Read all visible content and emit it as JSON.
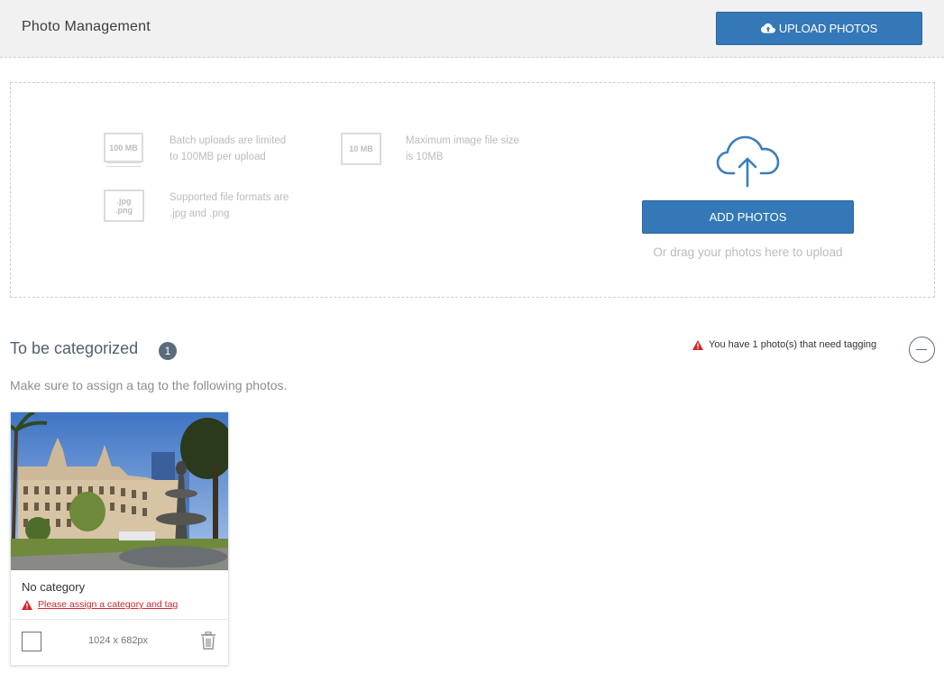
{
  "header": {
    "title": "Photo Management",
    "upload_button": "UPLOAD PHOTOS"
  },
  "dropzone": {
    "info": [
      {
        "icon_label": "100 MB",
        "icon": "batch-limit-icon",
        "text_line1": "Batch uploads are limited",
        "text_line2": "to 100MB per upload"
      },
      {
        "icon_label": "10 MB",
        "icon": "file-size-icon",
        "text_line1": "Maximum image file size",
        "text_line2": "is 10MB"
      },
      {
        "icon_label_line1": ".jpg",
        "icon_label_line2": ".png",
        "icon": "file-format-icon",
        "text_line1": "Supported file formats are",
        "text_line2": ".jpg and .png"
      }
    ],
    "add_button": "ADD PHOTOS",
    "drag_hint": "Or drag your photos here to upload"
  },
  "section": {
    "title": "To be categorized",
    "count": "1",
    "warning": "You have 1 photo(s) that need tagging",
    "subtitle": "Make sure to assign a tag to the following photos."
  },
  "photos": [
    {
      "category": "No category",
      "warning": "Please assign a category and tag",
      "dimensions": "1024 x 682px"
    }
  ],
  "colors": {
    "primary_button": "#3478b8",
    "warning_red": "#d0282e",
    "badge": "#5b6b7b"
  }
}
